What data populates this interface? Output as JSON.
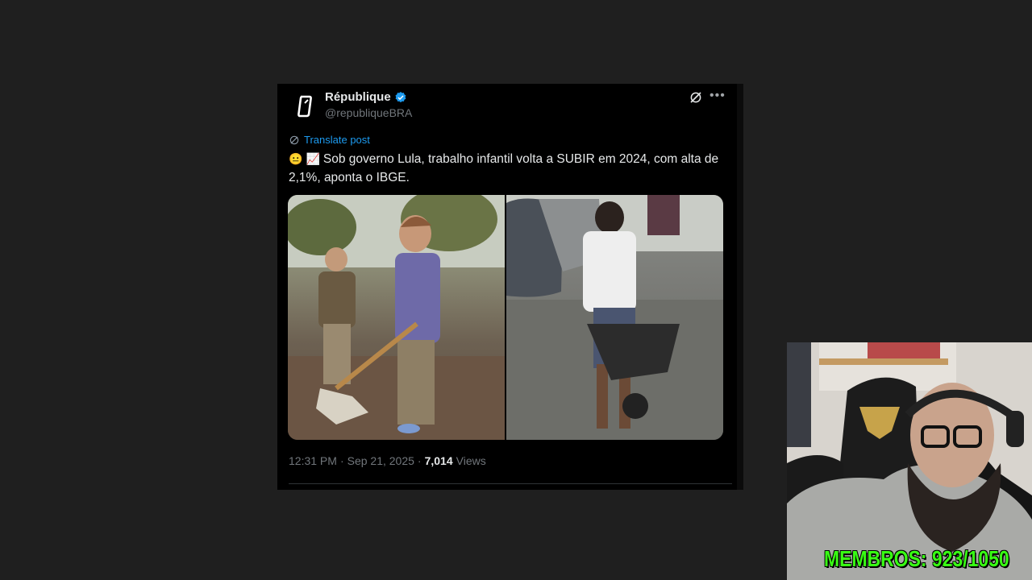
{
  "tweet": {
    "author_name": "République",
    "handle": "@republiqueBRA",
    "translate_label": "Translate post",
    "emojis": [
      "😐",
      "📈"
    ],
    "text": "Sob governo Lula, trabalho infantil volta a SUBIR em 2024, com alta de 2,1%, aponta o IBGE.",
    "time": "12:31 PM",
    "separator": "·",
    "date": "Sep 21, 2025",
    "views_count": "7,014",
    "views_label": "Views",
    "media": [
      {
        "description": "children-working-with-shovel"
      },
      {
        "description": "boy-pushing-wheelbarrow"
      }
    ],
    "accent_color": "#1d9bf0"
  },
  "overlay": {
    "members_text": "MEMBROS: 923/1050",
    "members_color": "#39ff14"
  }
}
